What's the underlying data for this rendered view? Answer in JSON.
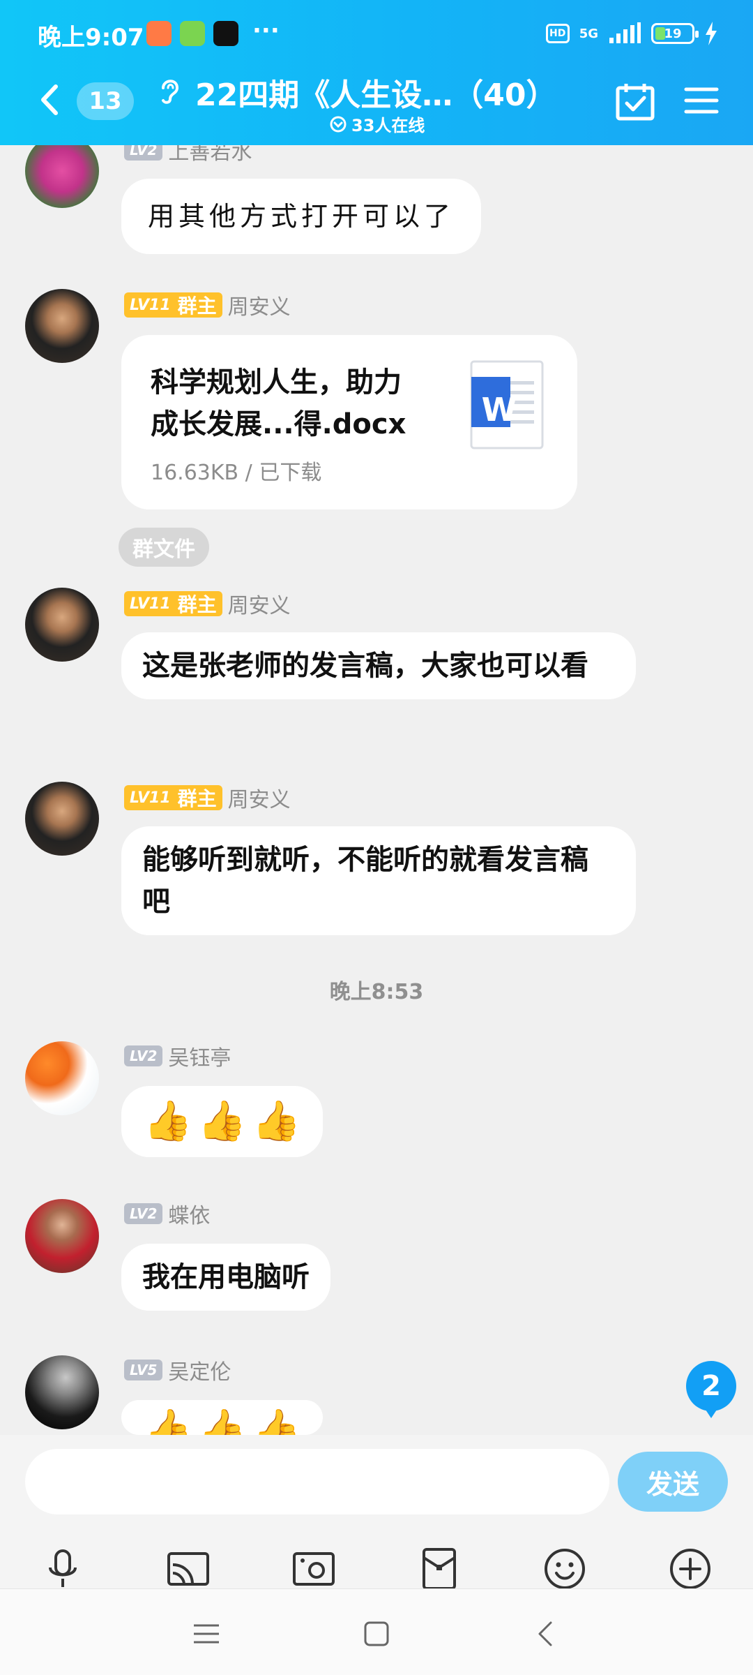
{
  "status_bar": {
    "time": "晚上9:07",
    "dots": "···",
    "hd": "HD",
    "network": "5G",
    "battery": "19"
  },
  "header": {
    "unread_count": "13",
    "group_title": "22四期《人生设…（40）",
    "online": "33人在线"
  },
  "messages": [
    {
      "level": "LV2",
      "sender": "上善若水",
      "text": "用其他方式打开可以了"
    },
    {
      "level": "LV11",
      "role": "群主",
      "sender": "周安义",
      "file": {
        "name": "科学规划人生，助力成长发展...得.docx",
        "meta": "16.63KB / 已下载",
        "type_letter": "W"
      },
      "tag": "群文件"
    },
    {
      "level": "LV11",
      "role": "群主",
      "sender": "周安义",
      "text": "这是张老师的发言稿，大家也可以看"
    },
    {
      "level": "LV11",
      "role": "群主",
      "sender": "周安义",
      "text": "能够听到就听，不能听的就看发言稿吧"
    },
    {
      "level": "LV2",
      "sender": "吴钰亭",
      "emoji": [
        "👍",
        "👍",
        "👍"
      ]
    },
    {
      "level": "LV2",
      "sender": "蝶依",
      "text": "我在用电脑听"
    },
    {
      "level": "LV5",
      "sender": "吴定伦",
      "emoji": [
        "👍",
        "👍",
        "👍"
      ]
    }
  ],
  "time_divider": "晚上8:53",
  "new_message_badge": "2",
  "input": {
    "value": "",
    "send_label": "发送"
  },
  "toolbar_icons": [
    "microphone-icon",
    "screen-cast-icon",
    "image-icon",
    "red-packet-icon",
    "emoji-icon",
    "plus-icon"
  ],
  "nav_icons": [
    "recent-apps-icon",
    "home-icon",
    "back-icon"
  ],
  "colors": {
    "header_gradient_start": "#11c6f8",
    "header_gradient_end": "#1aa7f4",
    "owner_badge": "#ffc12b",
    "level_badge": "#b9bec9",
    "send_button": "#7fd0f8",
    "badge_blue": "#129ff5",
    "chat_background": "#f0f0f0"
  }
}
